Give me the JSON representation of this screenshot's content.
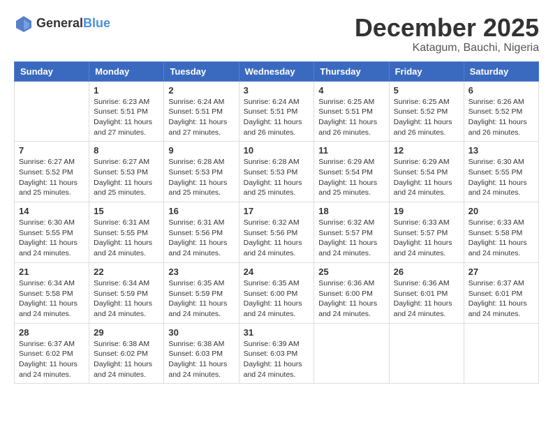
{
  "logo": {
    "text_general": "General",
    "text_blue": "Blue"
  },
  "title": {
    "month_year": "December 2025",
    "location": "Katagum, Bauchi, Nigeria"
  },
  "days_of_week": [
    "Sunday",
    "Monday",
    "Tuesday",
    "Wednesday",
    "Thursday",
    "Friday",
    "Saturday"
  ],
  "weeks": [
    [
      {
        "day": "",
        "sunrise": "",
        "sunset": "",
        "daylight": ""
      },
      {
        "day": "1",
        "sunrise": "Sunrise: 6:23 AM",
        "sunset": "Sunset: 5:51 PM",
        "daylight": "Daylight: 11 hours and 27 minutes."
      },
      {
        "day": "2",
        "sunrise": "Sunrise: 6:24 AM",
        "sunset": "Sunset: 5:51 PM",
        "daylight": "Daylight: 11 hours and 27 minutes."
      },
      {
        "day": "3",
        "sunrise": "Sunrise: 6:24 AM",
        "sunset": "Sunset: 5:51 PM",
        "daylight": "Daylight: 11 hours and 26 minutes."
      },
      {
        "day": "4",
        "sunrise": "Sunrise: 6:25 AM",
        "sunset": "Sunset: 5:51 PM",
        "daylight": "Daylight: 11 hours and 26 minutes."
      },
      {
        "day": "5",
        "sunrise": "Sunrise: 6:25 AM",
        "sunset": "Sunset: 5:52 PM",
        "daylight": "Daylight: 11 hours and 26 minutes."
      },
      {
        "day": "6",
        "sunrise": "Sunrise: 6:26 AM",
        "sunset": "Sunset: 5:52 PM",
        "daylight": "Daylight: 11 hours and 26 minutes."
      }
    ],
    [
      {
        "day": "7",
        "sunrise": "Sunrise: 6:27 AM",
        "sunset": "Sunset: 5:52 PM",
        "daylight": "Daylight: 11 hours and 25 minutes."
      },
      {
        "day": "8",
        "sunrise": "Sunrise: 6:27 AM",
        "sunset": "Sunset: 5:53 PM",
        "daylight": "Daylight: 11 hours and 25 minutes."
      },
      {
        "day": "9",
        "sunrise": "Sunrise: 6:28 AM",
        "sunset": "Sunset: 5:53 PM",
        "daylight": "Daylight: 11 hours and 25 minutes."
      },
      {
        "day": "10",
        "sunrise": "Sunrise: 6:28 AM",
        "sunset": "Sunset: 5:53 PM",
        "daylight": "Daylight: 11 hours and 25 minutes."
      },
      {
        "day": "11",
        "sunrise": "Sunrise: 6:29 AM",
        "sunset": "Sunset: 5:54 PM",
        "daylight": "Daylight: 11 hours and 25 minutes."
      },
      {
        "day": "12",
        "sunrise": "Sunrise: 6:29 AM",
        "sunset": "Sunset: 5:54 PM",
        "daylight": "Daylight: 11 hours and 24 minutes."
      },
      {
        "day": "13",
        "sunrise": "Sunrise: 6:30 AM",
        "sunset": "Sunset: 5:55 PM",
        "daylight": "Daylight: 11 hours and 24 minutes."
      }
    ],
    [
      {
        "day": "14",
        "sunrise": "Sunrise: 6:30 AM",
        "sunset": "Sunset: 5:55 PM",
        "daylight": "Daylight: 11 hours and 24 minutes."
      },
      {
        "day": "15",
        "sunrise": "Sunrise: 6:31 AM",
        "sunset": "Sunset: 5:55 PM",
        "daylight": "Daylight: 11 hours and 24 minutes."
      },
      {
        "day": "16",
        "sunrise": "Sunrise: 6:31 AM",
        "sunset": "Sunset: 5:56 PM",
        "daylight": "Daylight: 11 hours and 24 minutes."
      },
      {
        "day": "17",
        "sunrise": "Sunrise: 6:32 AM",
        "sunset": "Sunset: 5:56 PM",
        "daylight": "Daylight: 11 hours and 24 minutes."
      },
      {
        "day": "18",
        "sunrise": "Sunrise: 6:32 AM",
        "sunset": "Sunset: 5:57 PM",
        "daylight": "Daylight: 11 hours and 24 minutes."
      },
      {
        "day": "19",
        "sunrise": "Sunrise: 6:33 AM",
        "sunset": "Sunset: 5:57 PM",
        "daylight": "Daylight: 11 hours and 24 minutes."
      },
      {
        "day": "20",
        "sunrise": "Sunrise: 6:33 AM",
        "sunset": "Sunset: 5:58 PM",
        "daylight": "Daylight: 11 hours and 24 minutes."
      }
    ],
    [
      {
        "day": "21",
        "sunrise": "Sunrise: 6:34 AM",
        "sunset": "Sunset: 5:58 PM",
        "daylight": "Daylight: 11 hours and 24 minutes."
      },
      {
        "day": "22",
        "sunrise": "Sunrise: 6:34 AM",
        "sunset": "Sunset: 5:59 PM",
        "daylight": "Daylight: 11 hours and 24 minutes."
      },
      {
        "day": "23",
        "sunrise": "Sunrise: 6:35 AM",
        "sunset": "Sunset: 5:59 PM",
        "daylight": "Daylight: 11 hours and 24 minutes."
      },
      {
        "day": "24",
        "sunrise": "Sunrise: 6:35 AM",
        "sunset": "Sunset: 6:00 PM",
        "daylight": "Daylight: 11 hours and 24 minutes."
      },
      {
        "day": "25",
        "sunrise": "Sunrise: 6:36 AM",
        "sunset": "Sunset: 6:00 PM",
        "daylight": "Daylight: 11 hours and 24 minutes."
      },
      {
        "day": "26",
        "sunrise": "Sunrise: 6:36 AM",
        "sunset": "Sunset: 6:01 PM",
        "daylight": "Daylight: 11 hours and 24 minutes."
      },
      {
        "day": "27",
        "sunrise": "Sunrise: 6:37 AM",
        "sunset": "Sunset: 6:01 PM",
        "daylight": "Daylight: 11 hours and 24 minutes."
      }
    ],
    [
      {
        "day": "28",
        "sunrise": "Sunrise: 6:37 AM",
        "sunset": "Sunset: 6:02 PM",
        "daylight": "Daylight: 11 hours and 24 minutes."
      },
      {
        "day": "29",
        "sunrise": "Sunrise: 6:38 AM",
        "sunset": "Sunset: 6:02 PM",
        "daylight": "Daylight: 11 hours and 24 minutes."
      },
      {
        "day": "30",
        "sunrise": "Sunrise: 6:38 AM",
        "sunset": "Sunset: 6:03 PM",
        "daylight": "Daylight: 11 hours and 24 minutes."
      },
      {
        "day": "31",
        "sunrise": "Sunrise: 6:39 AM",
        "sunset": "Sunset: 6:03 PM",
        "daylight": "Daylight: 11 hours and 24 minutes."
      },
      {
        "day": "",
        "sunrise": "",
        "sunset": "",
        "daylight": ""
      },
      {
        "day": "",
        "sunrise": "",
        "sunset": "",
        "daylight": ""
      },
      {
        "day": "",
        "sunrise": "",
        "sunset": "",
        "daylight": ""
      }
    ]
  ]
}
